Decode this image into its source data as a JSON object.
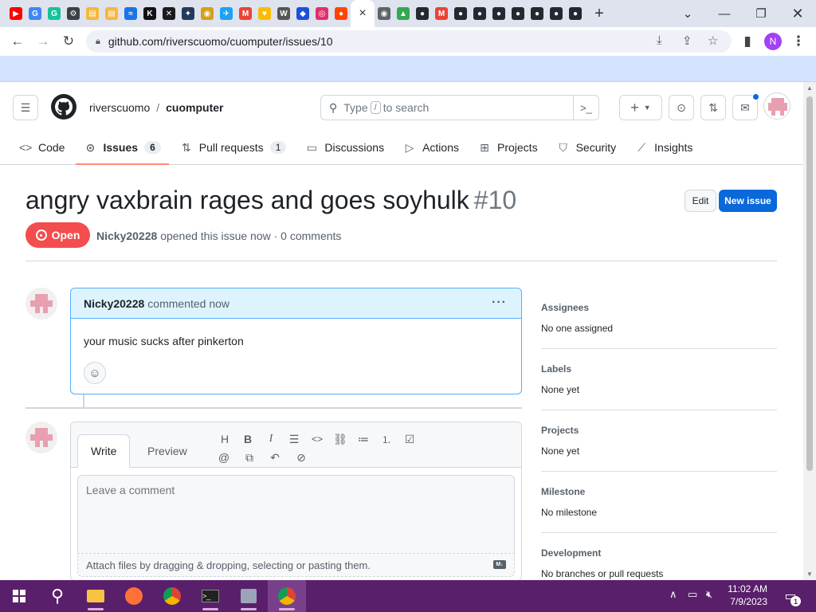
{
  "browser": {
    "active_tab_close": "×",
    "new_tab": "+",
    "url": "github.com/riverscuomo/cuomputer/issues/10",
    "profile_initial": "N",
    "tab_favicons": [
      {
        "icon": "youtube-icon",
        "color": "#ff0000",
        "glyph": "▶"
      },
      {
        "icon": "google-icon",
        "color": "#4285f4",
        "glyph": "G"
      },
      {
        "icon": "grammarly-icon",
        "color": "#15c39a",
        "glyph": "G"
      },
      {
        "icon": "settings-icon",
        "color": "#3c4043",
        "glyph": "⚙"
      },
      {
        "icon": "folder-icon",
        "color": "#f6b73c",
        "glyph": "▤"
      },
      {
        "icon": "folder-icon",
        "color": "#f6b73c",
        "glyph": "▤"
      },
      {
        "icon": "chart-icon",
        "color": "#1a73e8",
        "glyph": "≈"
      },
      {
        "icon": "kim-icon",
        "color": "#111111",
        "glyph": "K"
      },
      {
        "icon": "game-icon",
        "color": "#1b1b1b",
        "glyph": "✕"
      },
      {
        "icon": "puzzle-icon",
        "color": "#23395d",
        "glyph": "✦"
      },
      {
        "icon": "coin-icon",
        "color": "#d4a017",
        "glyph": "◉"
      },
      {
        "icon": "twitter-icon",
        "color": "#1da1f2",
        "glyph": "✈"
      },
      {
        "icon": "gmail-icon",
        "color": "#ea4335",
        "glyph": "M"
      },
      {
        "icon": "bulb-icon",
        "color": "#fbbc04",
        "glyph": "♥"
      },
      {
        "icon": "wiki-icon",
        "color": "#555555",
        "glyph": "W"
      },
      {
        "icon": "sonic-icon",
        "color": "#1e4fd8",
        "glyph": "◆"
      },
      {
        "icon": "instagram-icon",
        "color": "#e1306c",
        "glyph": "◎"
      },
      {
        "icon": "reddit-icon",
        "color": "#ff4500",
        "glyph": "●"
      }
    ],
    "tab_favicons_right": [
      {
        "icon": "chrome-icon",
        "color": "#5f6368",
        "glyph": "◉"
      },
      {
        "icon": "drive-icon",
        "color": "#34a853",
        "glyph": "▲"
      },
      {
        "icon": "github-icon",
        "color": "#24292f",
        "glyph": "●"
      },
      {
        "icon": "gmail-icon",
        "color": "#ea4335",
        "glyph": "M"
      },
      {
        "icon": "github-icon",
        "color": "#24292f",
        "glyph": "●"
      },
      {
        "icon": "github-icon",
        "color": "#24292f",
        "glyph": "●"
      },
      {
        "icon": "github-icon",
        "color": "#24292f",
        "glyph": "●"
      },
      {
        "icon": "github-icon",
        "color": "#24292f",
        "glyph": "●"
      },
      {
        "icon": "github-icon",
        "color": "#24292f",
        "glyph": "●"
      },
      {
        "icon": "github-icon",
        "color": "#24292f",
        "glyph": "●"
      },
      {
        "icon": "github-icon",
        "color": "#24292f",
        "glyph": "●"
      }
    ]
  },
  "repo": {
    "owner": "riverscuomo",
    "separator": "/",
    "name": "cuomputer"
  },
  "search": {
    "placeholder_before": "Type",
    "slash_key": "/",
    "placeholder_after": "to search"
  },
  "nav": {
    "code": "Code",
    "issues": "Issues",
    "issues_count": "6",
    "pulls": "Pull requests",
    "pulls_count": "1",
    "discussions": "Discussions",
    "actions": "Actions",
    "projects": "Projects",
    "security": "Security",
    "insights": "Insights"
  },
  "issue": {
    "title": "angry vaxbrain rages and goes soyhulk",
    "number": "#10",
    "edit_label": "Edit",
    "new_issue_label": "New issue",
    "state": "Open",
    "author": "Nicky20228",
    "meta": "opened this issue now · 0 comments"
  },
  "comment": {
    "author": "Nicky20228",
    "action": "commented now",
    "menu": "···",
    "body": "your music sucks after pinkerton"
  },
  "editor": {
    "tab_write": "Write",
    "tab_preview": "Preview",
    "placeholder": "Leave a comment",
    "attach_hint": "Attach files by dragging & dropping, selecting or pasting them.",
    "md_badge": "M↓"
  },
  "sidebar": {
    "sections": [
      {
        "heading": "Assignees",
        "value": "No one assigned"
      },
      {
        "heading": "Labels",
        "value": "None yet"
      },
      {
        "heading": "Projects",
        "value": "None yet"
      },
      {
        "heading": "Milestone",
        "value": "No milestone"
      },
      {
        "heading": "Development",
        "value": "No branches or pull requests"
      }
    ]
  },
  "taskbar": {
    "time": "11:02 AM",
    "date": "7/9/2023",
    "notification_count": "1"
  },
  "colors": {
    "open_badge": "#f34d4d",
    "primary_button": "#0969da",
    "comment_header": "#ddf4ff",
    "taskbar": "#5a1f6b",
    "nav_underline": "#fd8c73"
  }
}
